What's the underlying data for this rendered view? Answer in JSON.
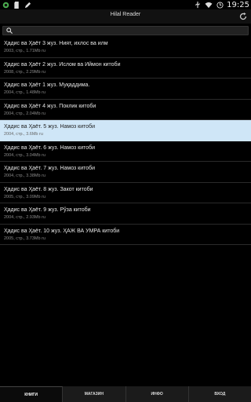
{
  "status": {
    "time": "19:25",
    "icons": [
      "whatsapp-icon",
      "sd-card-icon",
      "edit-icon",
      "usb-icon",
      "wifi-icon",
      "clock-icon"
    ]
  },
  "appbar": {
    "title": "Hilal Reader"
  },
  "search": {
    "value": ""
  },
  "books": [
    {
      "title": "Ҳадис ва Ҳаёт 3 жуз. Ният, ихлос ва илм",
      "meta": "2003, стр., 1.71Mb ru"
    },
    {
      "title": "Ҳадис ва Ҳаёт 2 жуз. Ислом ва Иймон китоби",
      "meta": "2008, стр., 2.29Mb ru"
    },
    {
      "title": "Ҳадис ва Ҳаёт 1 жуз. Муқаддима.",
      "meta": "2004, стр., 1.48Mb ru"
    },
    {
      "title": "Ҳадис ва Ҳаёт 4 жуз. Поклик китоби",
      "meta": "2004, стр., 2.04Mb ru"
    },
    {
      "title": "Ҳадис ва Ҳаёт. 5 жуз. Намоз китоби",
      "meta": "2004, стр., 3.6Mb ru"
    },
    {
      "title": "Ҳадис ва Ҳаёт. 6 жуз. Намоз китоби",
      "meta": "2004, стр., 3.04Mb ru"
    },
    {
      "title": "Ҳадис ва Ҳаёт. 7 жуз. Намоз китоби",
      "meta": "2004, стр., 3.38Mb ru"
    },
    {
      "title": "Ҳадис ва Ҳаёт. 8 жуз. Закот китоби",
      "meta": "2005, стр., 3.09Mb ru"
    },
    {
      "title": "Ҳадис ва Ҳаёт. 9 жуз. Рўза китоби",
      "meta": "2004, стр., 2.93Mb ru"
    },
    {
      "title": "Ҳадис ва Ҳаёт. 10 жуз. ҲАЖ ВА УМРА китоби",
      "meta": "2005, стр., 3.73Mb ru"
    }
  ],
  "selected_index": 4,
  "tabs": [
    {
      "label": "КНИГИ",
      "active": true
    },
    {
      "label": "МАГАЗИН",
      "active": false
    },
    {
      "label": "ИНФО",
      "active": false
    },
    {
      "label": "ВХОД",
      "active": false
    }
  ],
  "colors": {
    "selected_row": "#cfe6f7",
    "background": "#000000"
  }
}
